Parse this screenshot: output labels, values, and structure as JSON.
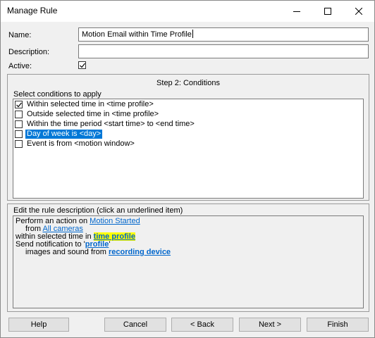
{
  "window": {
    "title": "Manage Rule",
    "controls": [
      "minimize-icon",
      "maximize-icon",
      "close-icon"
    ]
  },
  "form": {
    "name_label": "Name:",
    "name_value": "Motion Email within Time Profile",
    "description_label": "Description:",
    "description_value": "",
    "active_label": "Active:",
    "active_checked": true
  },
  "step": {
    "title": "Step 2: Conditions",
    "conditions_label": "Select conditions to apply",
    "conditions": [
      {
        "label": "Within selected time in <time profile>",
        "checked": true,
        "selected": false
      },
      {
        "label": "Outside selected time in <time profile>",
        "checked": false,
        "selected": false
      },
      {
        "label": "Within the time period <start time> to <end time>",
        "checked": false,
        "selected": false
      },
      {
        "label": "Day of week is <day>",
        "checked": false,
        "selected": true
      },
      {
        "label": "Event is from <motion window>",
        "checked": false,
        "selected": false
      }
    ]
  },
  "rule": {
    "label": "Edit the rule description (click an underlined item)",
    "line1_text": "Perform an action on ",
    "line1_link": "Motion Started",
    "line2_text": "from ",
    "line2_link": "All cameras",
    "line3_text": "within selected time in ",
    "line3_link": "time profile",
    "line4_text": "Send notification to '",
    "line4_link": "profile",
    "line4_after": "'",
    "line5_text": "images and sound from ",
    "line5_link": "recording device"
  },
  "buttons": {
    "help": "Help",
    "cancel": "Cancel",
    "back": "< Back",
    "next": "Next >",
    "finish": "Finish"
  },
  "colors": {
    "selection": "#0078d7",
    "link": "#0066cc",
    "highlight": "#ffff00"
  }
}
